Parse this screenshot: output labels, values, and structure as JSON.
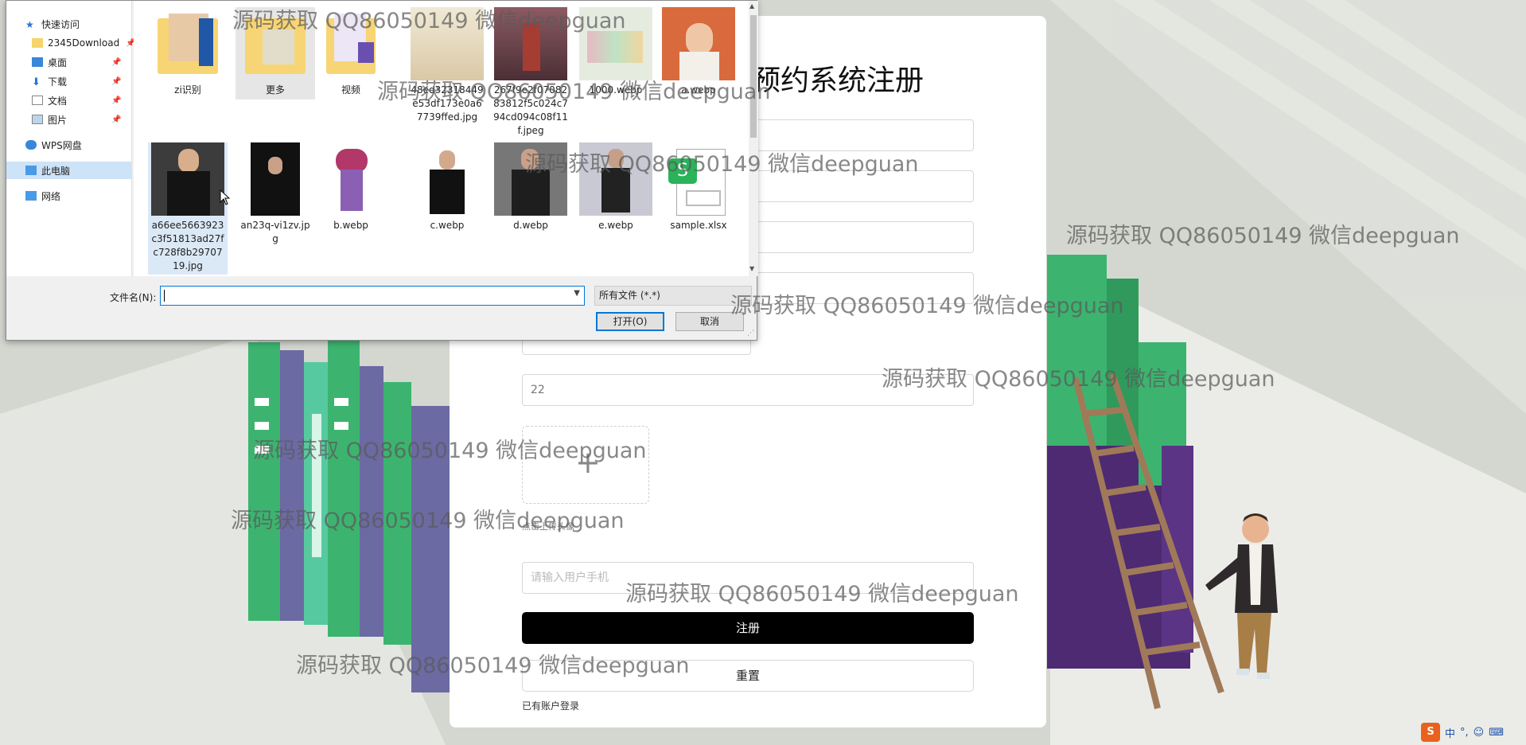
{
  "registration": {
    "title": "预约系统注册",
    "age_value": "22",
    "upload_hint": "点击上传头像",
    "phone_placeholder": "请输入用户手机",
    "register_button": "注册",
    "reset_button": "重置",
    "login_link": "已有账户登录"
  },
  "dialog": {
    "nav": {
      "quick_access": "快速访问",
      "items": [
        "2345Download",
        "桌面",
        "下载",
        "文档",
        "图片"
      ],
      "wps": "WPS网盘",
      "this_pc": "此电脑",
      "network": "网络"
    },
    "files_row1": [
      "zi识别",
      "更多",
      "视频",
      "48ed32318449e53df173e0a67739ffed.jpg",
      "267f9e2f0708283812f5c024c794cd094c08f11f.jpeg",
      "1000.webp",
      "a.webp"
    ],
    "files_row2": [
      "a66ee5663923c3f51813ad27fc728f8b2970719.jpg",
      "an23q-vi1zv.jpg",
      "b.webp",
      "c.webp",
      "d.webp",
      "e.webp",
      "sample.xlsx"
    ],
    "filename_label": "文件名(N):",
    "filename_value": "",
    "filter": "所有文件 (*.*)",
    "open_button": "打开(O)",
    "cancel_button": "取消"
  },
  "watermark": "源码获取 QQ86050149 微信deepguan",
  "tray": {
    "ime_icon": "S",
    "lang": "中",
    "punct": "°,",
    "face": "☺",
    "keyboard": "⌨"
  },
  "colors": {
    "accent": "#0078d7",
    "register_bg": "#000000",
    "book_green": "#3aa96b",
    "book_purple": "#4d2a72"
  }
}
